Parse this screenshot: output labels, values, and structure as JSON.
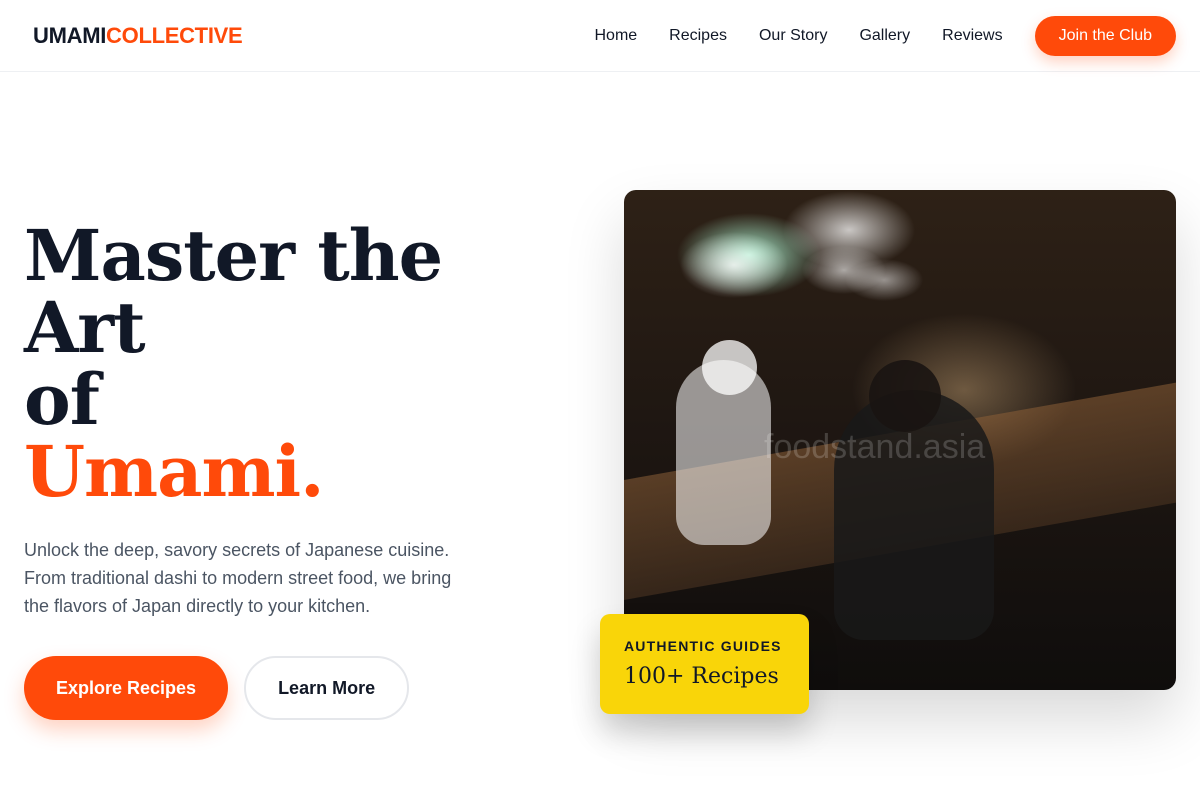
{
  "brand": {
    "left": "UMAMI",
    "right": "COLLECTIVE"
  },
  "nav": {
    "items": [
      "Home",
      "Recipes",
      "Our Story",
      "Gallery",
      "Reviews"
    ],
    "cta": "Join the Club"
  },
  "hero": {
    "title_lines": [
      "Master the Art",
      "of",
      "Umami."
    ],
    "description": "Unlock the deep, savory secrets of Japanese cuisine. From traditional dashi to modern street food, we bring the flavors of Japan directly to your kitchen.",
    "primary_button": "Explore Recipes",
    "secondary_button": "Learn More"
  },
  "image": {
    "watermark": "foodstand.asia"
  },
  "badge": {
    "top": "AUTHENTIC GUIDES",
    "main": "100+ Recipes"
  },
  "colors": {
    "accent": "#ff4a0a",
    "badge": "#f9d509",
    "text": "#111827",
    "muted": "#4b5563"
  }
}
